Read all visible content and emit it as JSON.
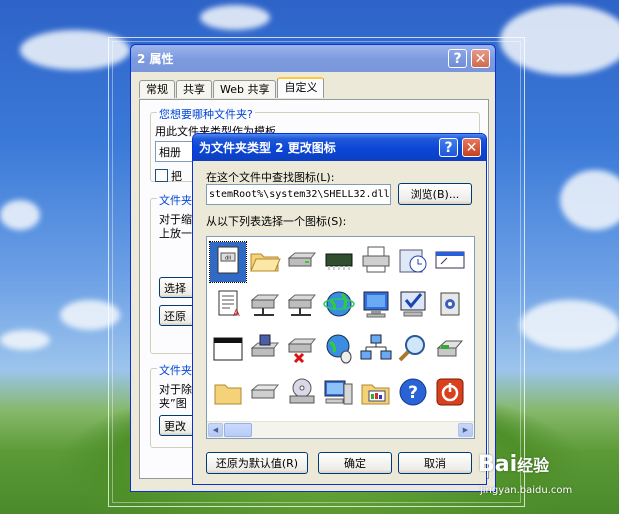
{
  "properties_window": {
    "title": "2 属性",
    "tabs": [
      "常规",
      "共享",
      "Web 共享",
      "自定义"
    ],
    "group1_title": "您想要哪种文件夹?",
    "group1_text": "用此文件夹类型作为模板",
    "combo_value": "相册",
    "checkbox_label": "把",
    "group2_title": "文件夹",
    "group2_text1": "对于缩",
    "group2_text2": "上放一",
    "choose_button": "选择",
    "restore_button": "还原",
    "group3_title": "文件夹",
    "group3_text1": "对于除",
    "group3_text2": "夹”图",
    "change_button": "更改"
  },
  "change_icon_dialog": {
    "title": "为文件夹类型 2 更改图标",
    "find_label": "在这个文件中查找图标(L):",
    "path_value": "stemRoot%\\system32\\SHELL32.dll",
    "browse_button": "浏览(B)...",
    "list_label": "从以下列表选择一个图标(S):",
    "icons": [
      "document-icon",
      "folder-open-icon",
      "drive-icon",
      "memory-chip-icon",
      "printer-icon",
      "clock-drive-icon",
      "window-icon",
      "text-document-icon",
      "network-drive-icon",
      "network-drive-icon",
      "internet-globe-icon",
      "monitor-icon",
      "check-monitor-icon",
      "speaker-file-icon",
      "application-window-icon",
      "floppy-drive-icon",
      "disconnected-drive-icon",
      "globe-mouse-icon",
      "network-icon",
      "search-icon",
      "scanner-icon",
      "folder-icon",
      "disk-drive-icon",
      "cd-drive-icon",
      "computer-icon",
      "control-panel-icon",
      "help-icon",
      "shutdown-icon"
    ],
    "restore_default_button": "还原为默认值(R)",
    "ok_button": "确定",
    "cancel_button": "取消"
  },
  "watermark": {
    "brand": "Bai",
    "suffix": "经验",
    "url": "jingyan.baidu.com"
  }
}
